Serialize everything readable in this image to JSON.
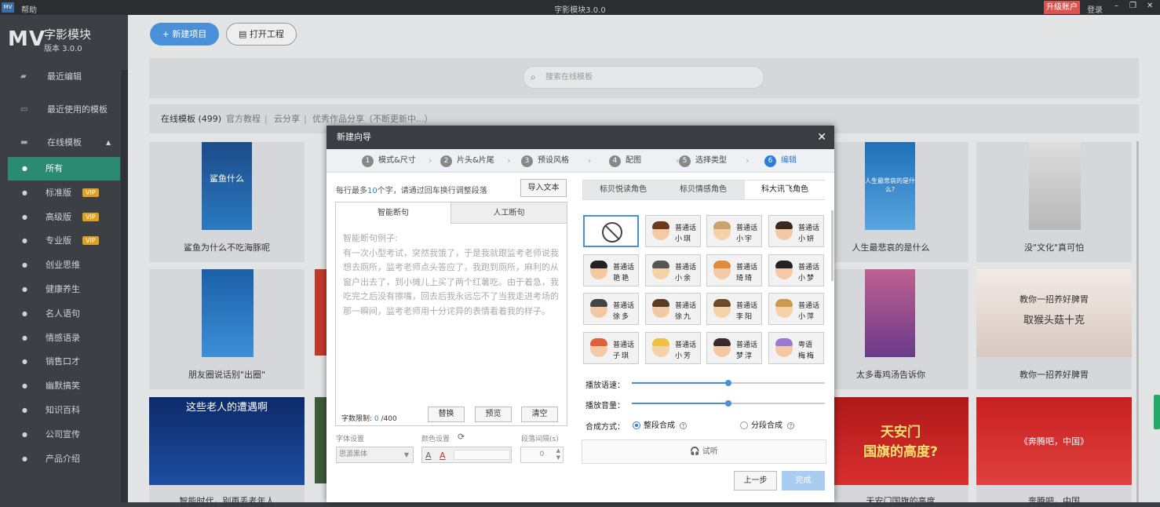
{
  "titlebar": {
    "app_icon": "MV",
    "help": "帮助",
    "title": "字影模块3.0.0",
    "upgrade": "升级账户",
    "login": "登录",
    "min": "–",
    "restore": "❐",
    "close": "✕"
  },
  "sidebar": {
    "logo": "MV",
    "app_name": "字影模块",
    "version": "版本 3.0.0",
    "items": [
      {
        "label": "最近编辑"
      },
      {
        "label": "最近使用的模板"
      },
      {
        "label": "在线模板"
      }
    ],
    "sub_items": [
      {
        "label": "所有",
        "vip": ""
      },
      {
        "label": "标准版",
        "vip": "VIP"
      },
      {
        "label": "高级版",
        "vip": "VIP"
      },
      {
        "label": "专业版",
        "vip": "VIP"
      },
      {
        "label": "创业思维",
        "vip": ""
      },
      {
        "label": "健康养生",
        "vip": ""
      },
      {
        "label": "名人语句",
        "vip": ""
      },
      {
        "label": "情感语录",
        "vip": ""
      },
      {
        "label": "销售口才",
        "vip": ""
      },
      {
        "label": "幽默搞笑",
        "vip": ""
      },
      {
        "label": "知识百科",
        "vip": ""
      },
      {
        "label": "公司宣传",
        "vip": ""
      },
      {
        "label": "产品介绍",
        "vip": ""
      }
    ]
  },
  "toolbar": {
    "new_project": "+ 新建项目",
    "open_project": "打开工程"
  },
  "search": {
    "placeholder": "搜索在线模板"
  },
  "tabs": {
    "online": "在线模板 (499)",
    "official": "官方教程",
    "cloud": "云分享",
    "excellent": "优秀作品分享（不断更新中...）",
    "sep": "|"
  },
  "cards": {
    "c1": {
      "caption": "鲨鱼为什么不吃海豚呢",
      "thumb_text": "鲨鱼什么"
    },
    "c2": {
      "caption": "人生最悲哀的是什么",
      "thumb_text": "人生最悲哀的是什么?"
    },
    "c3": {
      "caption": "没\"文化\"真可怕"
    },
    "c4": {
      "caption": "朋友圈说话别\"出圈\""
    },
    "c5": {
      "caption": "太多毒鸡汤告诉你"
    },
    "c6": {
      "caption": "教你一招养好脾胃",
      "thumb_text1": "教你一招养好脾胃",
      "thumb_text2": "取猴头菇十克"
    },
    "c7": {
      "caption": "智能时代，别再丢老年人",
      "thumb_text": "这些老人的遭遇啊"
    },
    "c8": {
      "caption": "天安门国旗的高度",
      "thumb_text1": "天安门",
      "thumb_text2": "国旗的高度?"
    },
    "c9": {
      "caption": "奔腾吧，中国",
      "thumb_text": "《奔腾吧，中国》"
    }
  },
  "dialog": {
    "title": "新建向导",
    "close": "✕",
    "steps": [
      {
        "num": "1",
        "label": "模式&尺寸"
      },
      {
        "num": "2",
        "label": "片头&片尾"
      },
      {
        "num": "3",
        "label": "预设风格"
      },
      {
        "num": "4",
        "label": "配图"
      },
      {
        "num": "5",
        "label": "选择类型"
      },
      {
        "num": "6",
        "label": "编辑"
      }
    ],
    "chevron": "›",
    "hint_pre": "每行最多",
    "hint_num": "10",
    "hint_post": "个字，请通过回车换行调整段落",
    "import_text": "导入文本",
    "text_tabs": {
      "smart": "智能断句",
      "manual": "人工断句"
    },
    "sample_text": "智能断句例子:\n有一次小型考试，突然我饿了，于是我就跟监考老师说我想去厕所，监考老师点头答应了，我跑到厕所，麻利的从窗户出去了，到小摊儿上买了两个红薯吃。由于着急，我吃完之后没有擦嘴，回去后我永远忘不了当我走进考场的那一瞬间，监考老师用十分诧异的表情看着我的样子。",
    "limit_label": "字数限制:",
    "limit_used": "0",
    "limit_max": "/400",
    "btn_replace": "替换",
    "btn_preview": "预览",
    "btn_clear": "清空",
    "font_label": "字体设置",
    "color_label": "颜色设置",
    "refresh": "⟳",
    "spacing_label": "段落间隔(s)",
    "font_value": "思源黑体",
    "spacing_value": "0",
    "voice_tabs": [
      "标贝悦读角色",
      "标贝情感角色",
      "科大讯飞角色"
    ],
    "voices": [
      {
        "l1": "",
        "l2": ""
      },
      {
        "l1": "普通话",
        "l2": "小琪",
        "hair": "#6b3a1e",
        "skin": "#f6c9a6"
      },
      {
        "l1": "普通话",
        "l2": "小宇",
        "hair": "#c8a36a",
        "skin": "#f6d2a8"
      },
      {
        "l1": "普通话",
        "l2": "小妍",
        "hair": "#3a2a20",
        "skin": "#f3c9a3"
      },
      {
        "l1": "普通话",
        "l2": "艳艳",
        "hair": "#222",
        "skin": "#f3c9a3"
      },
      {
        "l1": "普通话",
        "l2": "小余",
        "hair": "#555",
        "skin": "#f6d2a8"
      },
      {
        "l1": "普通话",
        "l2": "琦琦",
        "hair": "#e08a3a",
        "skin": "#f6c9a6"
      },
      {
        "l1": "普通话",
        "l2": "小梦",
        "hair": "#222",
        "skin": "#f6c9a6"
      },
      {
        "l1": "普通话",
        "l2": "徐多",
        "hair": "#444",
        "skin": "#f3c9a3"
      },
      {
        "l1": "普通话",
        "l2": "徐九",
        "hair": "#5a3a20",
        "skin": "#f3c9a3"
      },
      {
        "l1": "普通话",
        "l2": "李阳",
        "hair": "#6b4a2a",
        "skin": "#f6d2a8"
      },
      {
        "l1": "普通话",
        "l2": "小萍",
        "hair": "#c89a4a",
        "skin": "#f6d2a8"
      },
      {
        "l1": "普通话",
        "l2": "子琪",
        "hair": "#e0603a",
        "skin": "#f6c9a6"
      },
      {
        "l1": "普通话",
        "l2": "小芳",
        "hair": "#f0c040",
        "skin": "#f6d2a8"
      },
      {
        "l1": "普通话",
        "l2": "梦淳",
        "hair": "#3a2a30",
        "skin": "#f3c9a3"
      },
      {
        "l1": "粤语",
        "l2": "梅梅",
        "hair": "#9a7ad0",
        "skin": "#f3c9a3"
      }
    ],
    "speed_label": "播放语速：",
    "speed_value": 0.5,
    "volume_label": "播放音量：",
    "volume_value": 0.5,
    "synth_label": "合成方式：",
    "synth_whole": "整段合成",
    "synth_segment": "分段合成",
    "help": "?",
    "listen": "🎧 试听",
    "btn_prev": "上一步",
    "btn_done": "完成",
    "accent": "#2a7fd4"
  }
}
